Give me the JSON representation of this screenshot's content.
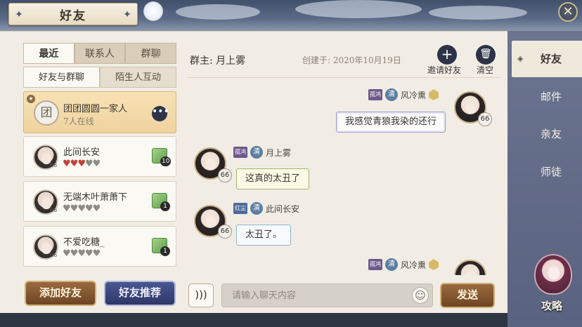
{
  "window": {
    "title": "好友",
    "close_glyph": "✕"
  },
  "left_panel": {
    "tabs": [
      {
        "label": "最近",
        "active": true
      },
      {
        "label": "联系人",
        "active": false
      },
      {
        "label": "群聊",
        "active": false
      }
    ],
    "subtabs": [
      {
        "label": "好友与群聊",
        "active": true
      },
      {
        "label": "陌生人互动",
        "active": false
      }
    ],
    "group": {
      "avatar_char": "团",
      "name": "团团圆圆一家人",
      "subtitle": "7人在线",
      "more_glyph": "•••"
    },
    "friends": [
      {
        "name": "此间长安",
        "level": "66",
        "hearts_filled": 3,
        "hearts_total": 5,
        "gift_count": "10"
      },
      {
        "name": "无端木叶萧萧下",
        "level": "66",
        "hearts_filled": 0,
        "hearts_total": 5,
        "gift_count": "1"
      },
      {
        "name": "不爱吃糖_",
        "level": "66",
        "hearts_filled": 0,
        "hearts_total": 5,
        "gift_count": "1"
      }
    ],
    "add_friend_label": "添加好友",
    "recommend_label": "好友推荐"
  },
  "chat": {
    "owner": "群主: 月上雾",
    "created": "创建于: 2020年10月19日",
    "invite_label": "邀请好友",
    "clear_label": "清空",
    "messages": [
      {
        "side": "right",
        "sender": "风冷熏",
        "title_tag": "孤鸿",
        "clan": "清",
        "level": "66",
        "text": "我感觉青狼我染的还行"
      },
      {
        "side": "left",
        "sender": "月上雾",
        "title_tag": "孤鸿",
        "clan": "清",
        "level": "66",
        "text": "这真的太丑了"
      },
      {
        "side": "left",
        "sender": "此间长安",
        "title_tag": "红尘",
        "clan": "清",
        "level": "66",
        "text": "太丑了。"
      },
      {
        "side": "right",
        "sender": "风冷熏",
        "title_tag": "孤鸿",
        "clan": "清",
        "level": "66",
        "text": ""
      }
    ],
    "input_placeholder": "请输入聊天内容",
    "send_label": "发送"
  },
  "sidebar": {
    "items": [
      {
        "label": "好友",
        "active": true
      },
      {
        "label": "邮件",
        "active": false
      },
      {
        "label": "亲友",
        "active": false
      },
      {
        "label": "师徒",
        "active": false
      }
    ],
    "guide_label": "攻略"
  },
  "colors": {
    "parchment": "#f1ede5",
    "accent_brown": "#6e4522",
    "accent_navy": "#2e3766",
    "heart_on": "#c2413d",
    "sidebar": "#5f6884"
  }
}
